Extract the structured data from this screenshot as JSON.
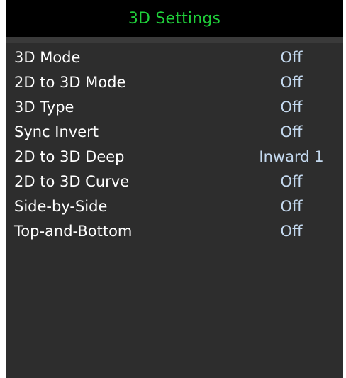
{
  "header": {
    "title": "3D Settings"
  },
  "colors": {
    "title": "#1fcf3a",
    "panel_background": "#2d2d2d",
    "header_background": "#000000",
    "label_text": "#ffffff",
    "value_text": "#c4d9ef"
  },
  "menu": {
    "items": [
      {
        "label": "3D Mode",
        "value": "Off"
      },
      {
        "label": "2D to 3D Mode",
        "value": "Off"
      },
      {
        "label": "3D Type",
        "value": "Off"
      },
      {
        "label": "Sync Invert",
        "value": "Off"
      },
      {
        "label": "2D to 3D Deep",
        "value": "Inward 1"
      },
      {
        "label": "2D to 3D Curve",
        "value": "Off"
      },
      {
        "label": "Side-by-Side",
        "value": "Off"
      },
      {
        "label": "Top-and-Bottom",
        "value": "Off"
      }
    ]
  }
}
